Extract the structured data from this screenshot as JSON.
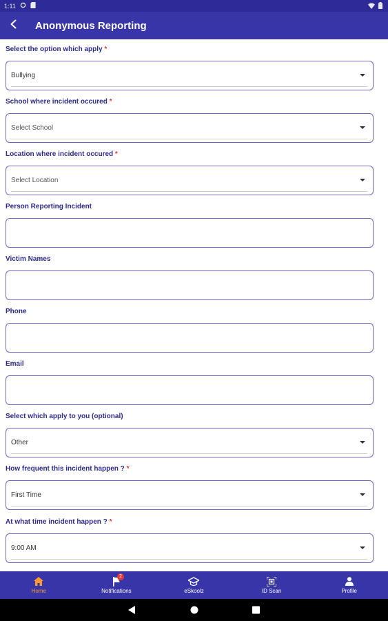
{
  "status_bar": {
    "time": "1:11"
  },
  "app_bar": {
    "title": "Anonymous Reporting"
  },
  "form": {
    "fields": [
      {
        "label": "Select the option which apply ",
        "required": "*",
        "value": "Bullying"
      },
      {
        "label": "School where incident occured ",
        "required": "*",
        "placeholder": "Select School"
      },
      {
        "label": "Location where incident occured ",
        "required": "*",
        "placeholder": "Select Location"
      },
      {
        "label": "Person Reporting Incident",
        "value": ""
      },
      {
        "label": "Victim Names",
        "value": ""
      },
      {
        "label": "Phone",
        "value": ""
      },
      {
        "label": "Email",
        "value": ""
      },
      {
        "label": "Select which apply to you (optional)",
        "value": "Other"
      },
      {
        "label": "How frequent this incident happen ? ",
        "required": "*",
        "value": "First Time"
      },
      {
        "label": "At what time incident happen ? ",
        "required": "*",
        "value": "9:00 AM"
      }
    ]
  },
  "bottom_nav": {
    "items": [
      {
        "label": "Home",
        "icon": "home-icon"
      },
      {
        "label": "Notifications",
        "icon": "flag-icon",
        "badge": "2"
      },
      {
        "label": "eSkoolz",
        "icon": "graduation-cap-icon"
      },
      {
        "label": "ID Scan",
        "icon": "qr-scan-icon"
      },
      {
        "label": "Profile",
        "icon": "person-icon"
      }
    ]
  },
  "colors": {
    "primary": "#3835a9",
    "active": "#ff9a2e",
    "required": "#e53935",
    "label": "#2c2a8a"
  }
}
